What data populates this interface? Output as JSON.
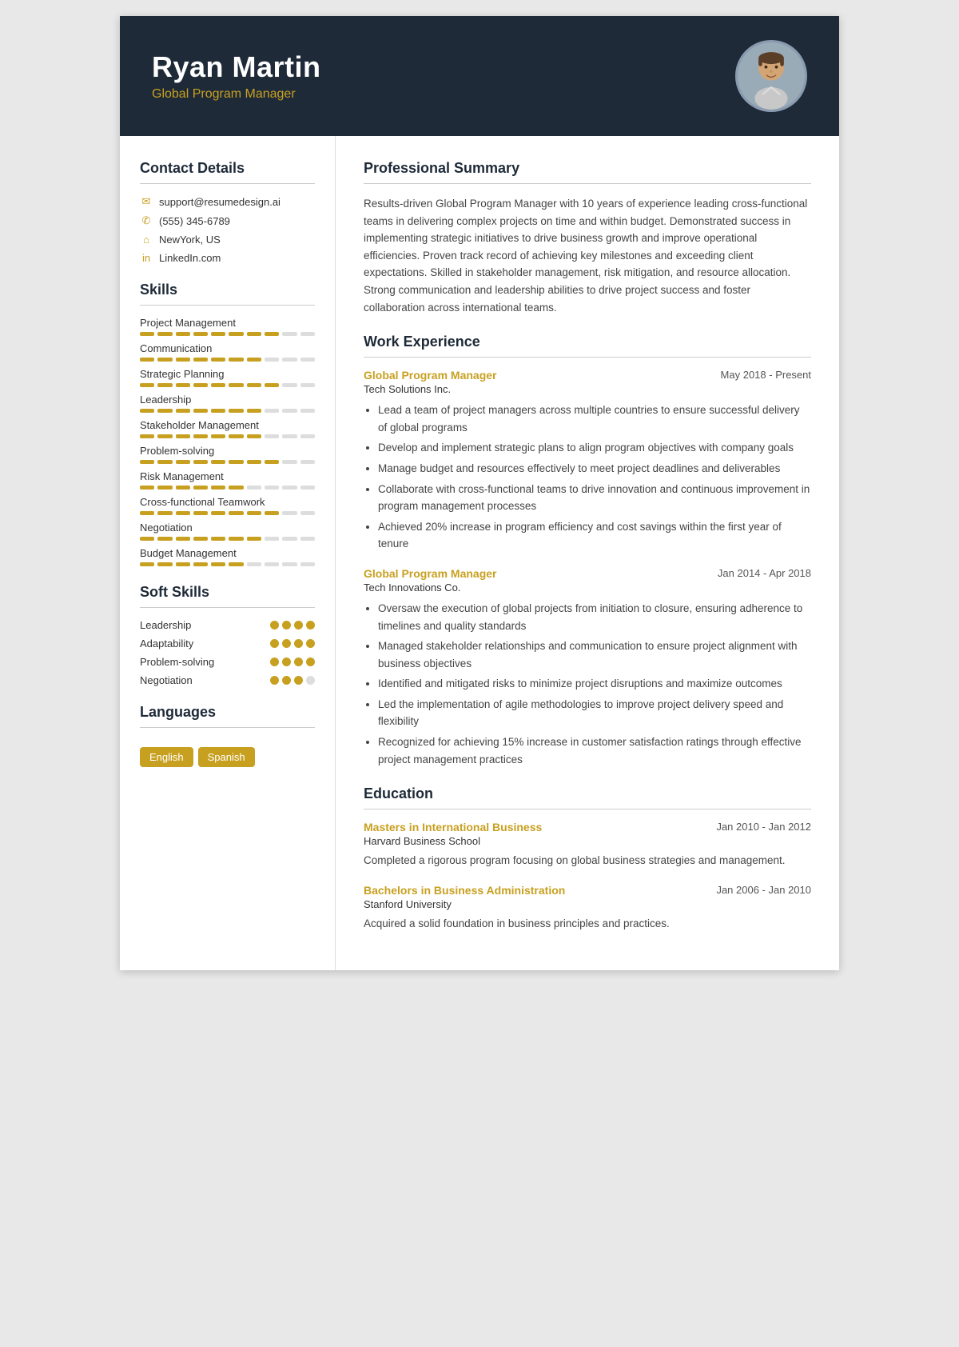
{
  "header": {
    "name": "Ryan Martin",
    "title": "Global Program Manager",
    "photo_alt": "Ryan Martin photo"
  },
  "contact": {
    "section_title": "Contact Details",
    "email": "support@resumedesign.ai",
    "phone": "(555) 345-6789",
    "location": "NewYork, US",
    "linkedin": "LinkedIn.com"
  },
  "skills": {
    "section_title": "Skills",
    "items": [
      {
        "name": "Project Management",
        "filled": 8,
        "total": 10
      },
      {
        "name": "Communication",
        "filled": 7,
        "total": 10
      },
      {
        "name": "Strategic Planning",
        "filled": 8,
        "total": 10
      },
      {
        "name": "Leadership",
        "filled": 7,
        "total": 10
      },
      {
        "name": "Stakeholder Management",
        "filled": 7,
        "total": 10
      },
      {
        "name": "Problem-solving",
        "filled": 8,
        "total": 10
      },
      {
        "name": "Risk Management",
        "filled": 6,
        "total": 10
      },
      {
        "name": "Cross-functional Teamwork",
        "filled": 8,
        "total": 10
      },
      {
        "name": "Negotiation",
        "filled": 7,
        "total": 10
      },
      {
        "name": "Budget Management",
        "filled": 6,
        "total": 10
      }
    ]
  },
  "soft_skills": {
    "section_title": "Soft Skills",
    "items": [
      {
        "name": "Leadership",
        "dots": 4,
        "total": 4
      },
      {
        "name": "Adaptability",
        "dots": 4,
        "total": 4
      },
      {
        "name": "Problem-solving",
        "dots": 4,
        "total": 4
      },
      {
        "name": "Negotiation",
        "dots": 3,
        "total": 4
      }
    ]
  },
  "languages": {
    "section_title": "Languages",
    "items": [
      "English",
      "Spanish"
    ]
  },
  "summary": {
    "section_title": "Professional Summary",
    "text": "Results-driven Global Program Manager with 10 years of experience leading cross-functional teams in delivering complex projects on time and within budget. Demonstrated success in implementing strategic initiatives to drive business growth and improve operational efficiencies. Proven track record of achieving key milestones and exceeding client expectations. Skilled in stakeholder management, risk mitigation, and resource allocation. Strong communication and leadership abilities to drive project success and foster collaboration across international teams."
  },
  "experience": {
    "section_title": "Work Experience",
    "jobs": [
      {
        "title": "Global Program Manager",
        "date": "May 2018 - Present",
        "company": "Tech Solutions Inc.",
        "bullets": [
          "Lead a team of project managers across multiple countries to ensure successful delivery of global programs",
          "Develop and implement strategic plans to align program objectives with company goals",
          "Manage budget and resources effectively to meet project deadlines and deliverables",
          "Collaborate with cross-functional teams to drive innovation and continuous improvement in program management processes",
          "Achieved 20% increase in program efficiency and cost savings within the first year of tenure"
        ]
      },
      {
        "title": "Global Program Manager",
        "date": "Jan 2014 - Apr 2018",
        "company": "Tech Innovations Co.",
        "bullets": [
          "Oversaw the execution of global projects from initiation to closure, ensuring adherence to timelines and quality standards",
          "Managed stakeholder relationships and communication to ensure project alignment with business objectives",
          "Identified and mitigated risks to minimize project disruptions and maximize outcomes",
          "Led the implementation of agile methodologies to improve project delivery speed and flexibility",
          "Recognized for achieving 15% increase in customer satisfaction ratings through effective project management practices"
        ]
      }
    ]
  },
  "education": {
    "section_title": "Education",
    "items": [
      {
        "degree": "Masters in International Business",
        "date": "Jan 2010 - Jan 2012",
        "school": "Harvard Business School",
        "description": "Completed a rigorous program focusing on global business strategies and management."
      },
      {
        "degree": "Bachelors in Business Administration",
        "date": "Jan 2006 - Jan 2010",
        "school": "Stanford University",
        "description": "Acquired a solid foundation in business principles and practices."
      }
    ]
  }
}
